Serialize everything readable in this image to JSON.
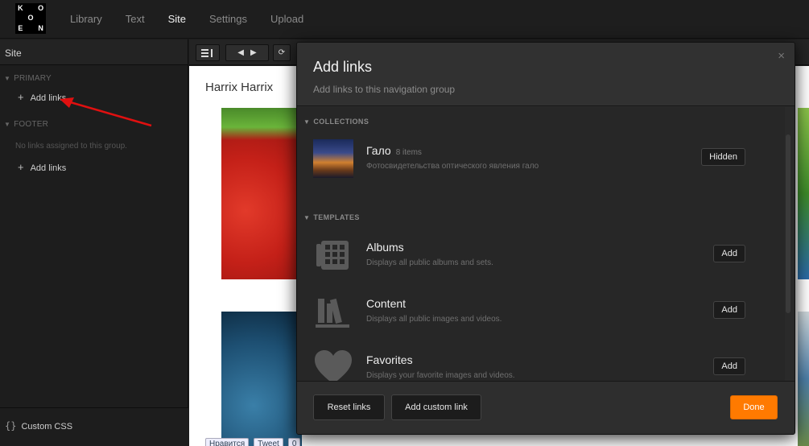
{
  "app": {
    "logo_letters": [
      "K",
      "",
      "O",
      "",
      "O",
      "",
      "E",
      "",
      "N"
    ],
    "nav": [
      {
        "label": "Library",
        "active": false
      },
      {
        "label": "Text",
        "active": false
      },
      {
        "label": "Site",
        "active": true
      },
      {
        "label": "Settings",
        "active": false
      },
      {
        "label": "Upload",
        "active": false
      }
    ]
  },
  "sidebar": {
    "header": "Site",
    "primary_label": "PRIMARY",
    "primary_add": "Add links",
    "footer_label": "FOOTER",
    "footer_empty": "No links assigned to this group.",
    "footer_add": "Add links",
    "custom_css": "Custom CSS"
  },
  "preview": {
    "site_title": "Harrix Harrix",
    "share_fb": "Нравится",
    "share_tw": "Tweet",
    "share_count": "0"
  },
  "modal": {
    "title": "Add links",
    "subtitle": "Add links to this navigation group",
    "close": "×",
    "collections_label": "COLLECTIONS",
    "collection": {
      "title": "Гало",
      "count": "8 items",
      "desc": "Фотосвидетельства оптического явления гало",
      "button": "Hidden"
    },
    "templates_label": "TEMPLATES",
    "templates": [
      {
        "title": "Albums",
        "desc": "Displays all public albums and sets.",
        "button": "Add",
        "icon": "albums-grid-icon"
      },
      {
        "title": "Content",
        "desc": "Displays all public images and videos.",
        "button": "Add",
        "icon": "books-icon"
      },
      {
        "title": "Favorites",
        "desc": "Displays your favorite images and videos.",
        "button": "Add",
        "icon": "heart-icon"
      }
    ],
    "reset": "Reset links",
    "add_custom": "Add custom link",
    "done": "Done"
  },
  "colors": {
    "accent": "#ff7a00",
    "arrow": "#e01010"
  }
}
